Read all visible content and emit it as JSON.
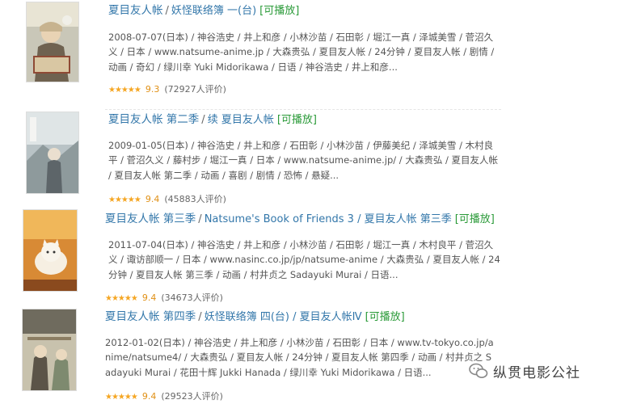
{
  "entries": [
    {
      "title": "夏目友人帐",
      "alt_title": "妖怪联络簿 一(台)",
      "playable": "[可播放]",
      "meta": "2008-07-07(日本) / 神谷浩史 / 井上和彦 / 小林沙苗 / 石田彰 / 堀江一真 / 泽城美雪 / 菅沼久义 / 日本 / www.natsume-anime.jp / 大森贵弘 / 夏目友人帐 / 24分钟 / 夏目友人帐 / 剧情 / 动画 / 奇幻 / 绿川幸 Yuki Midorikawa / 日语 / 神谷浩史 / 井上和彦...",
      "score": "9.3",
      "count": "(72927人评价)",
      "rating_fraction": 0.93
    },
    {
      "title": "夏目友人帐 第二季",
      "alt_title": "续 夏目友人帐",
      "playable": "[可播放]",
      "meta": "2009-01-05(日本) / 神谷浩史 / 井上和彦 / 石田彰 / 小林沙苗 / 伊藤美纪 / 泽城美雪 / 木村良平 / 菅沼久义 / 藤村步 / 堀江一真 / 日本 / www.natsume-anime.jp/ / 大森贵弘 / 夏目友人帐 / 夏目友人帐 第二季 / 动画 / 喜剧 / 剧情 / 恐怖 / 悬疑...",
      "score": "9.4",
      "count": "(45883人评价)",
      "rating_fraction": 0.94
    },
    {
      "title": "夏目友人帐 第三季",
      "alt_title": "Natsume's Book of Friends 3 / 夏目友人帐 第三季",
      "playable": "[可播放]",
      "meta": "2011-07-04(日本) / 神谷浩史 / 井上和彦 / 小林沙苗 / 石田彰 / 堀江一真 / 木村良平 / 菅沼久义 / 诹访部顺一 / 日本 / www.nasinc.co.jp/jp/natsume-anime / 大森贵弘 / 夏目友人帐 / 24分钟 / 夏目友人帐 第三季 / 动画 / 村井贞之 Sadayuki Murai / 日语...",
      "score": "9.4",
      "count": "(34673人评价)",
      "rating_fraction": 0.94
    },
    {
      "title": "夏目友人帐 第四季",
      "alt_title": "妖怪联络簿 四(台) / 夏目友人帐Ⅳ",
      "playable": "[可播放]",
      "meta": "2012-01-02(日本) / 神谷浩史 / 井上和彦 / 小林沙苗 / 石田彰 / 日本 / www.tv-tokyo.co.jp/anime/natsume4/ / 大森贵弘 / 夏目友人帐 / 24分钟 / 夏目友人帐 第四季 / 动画 / 村井贞之 Sadayuki Murai / 花田十辉 Jukki Hanada / 绿川幸 Yuki Midorikawa / 日语...",
      "score": "9.4",
      "count": "(29523人评价)",
      "rating_fraction": 0.94
    }
  ],
  "stars_text": "★★★★★",
  "watermark": "纵贯电影公社",
  "colors": {
    "link": "#3377aa",
    "playable": "#2a9a38",
    "star": "#f5a623",
    "score": "#e09015"
  }
}
